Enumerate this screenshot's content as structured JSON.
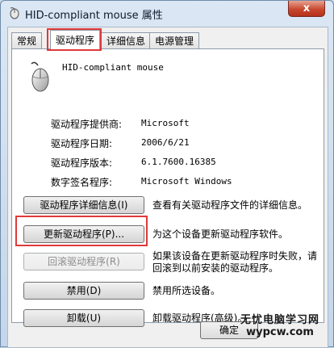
{
  "window": {
    "title": "HID-compliant mouse 属性",
    "close_glyph": "x"
  },
  "tabs": [
    {
      "label": "常规"
    },
    {
      "label": "驱动程序"
    },
    {
      "label": "详细信息"
    },
    {
      "label": "电源管理"
    }
  ],
  "device": {
    "name": "HID-compliant mouse"
  },
  "info": [
    {
      "label": "驱动程序提供商:",
      "value": "Microsoft"
    },
    {
      "label": "驱动程序日期:",
      "value": "2006/6/21"
    },
    {
      "label": "驱动程序版本:",
      "value": "6.1.7600.16385"
    },
    {
      "label": "数字签名程序:",
      "value": "Microsoft Windows"
    }
  ],
  "actions": [
    {
      "button": "驱动程序详细信息(I)",
      "description": [
        "查看有关驱动程序文件的详细信息。"
      ]
    },
    {
      "button": "更新驱动程序(P)...",
      "description": [
        "为这个设备更新驱动程序软件。"
      ]
    },
    {
      "button": "回滚驱动程序(R)",
      "description": [
        "如果该设备在更新驱动程序时失败，请",
        "回滚到以前安装的驱动程序。"
      ]
    },
    {
      "button": "禁用(D)",
      "description": [
        "禁用所选设备。"
      ]
    },
    {
      "button": "卸载(U)",
      "description": [
        "卸载驱动程序(高级)。"
      ]
    }
  ],
  "footer": {
    "ok_label": "确定"
  },
  "watermark": {
    "line1": "无忧电脑学习网",
    "line2": "wypcw.com"
  },
  "colors": {
    "highlight": "#e0393a",
    "close_button": "#c8492f"
  }
}
